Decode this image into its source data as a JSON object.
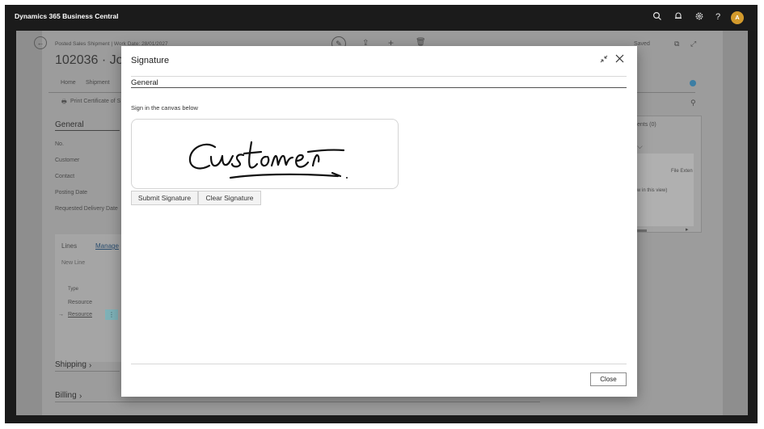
{
  "app": {
    "title": "Dynamics 365 Business Central",
    "user_initial": "A",
    "icons": [
      "search-icon",
      "bell-icon",
      "gear-icon",
      "help-icon"
    ]
  },
  "background_page": {
    "breadcrumb": "Posted Sales Shipment | Work Date: 28/01/2027",
    "title": "102036 · Joh",
    "saved_status": "Saved",
    "actions": [
      "Home",
      "Shipment"
    ],
    "print_action": "Print Certificate of S",
    "general_header": "General",
    "fields": [
      "No.",
      "Customer",
      "Contact",
      "Posting Date",
      "Requested Delivery Date"
    ],
    "lines_tab": "Lines",
    "manage_tab": "Manage",
    "new_line": "New Line",
    "line_type_header": "Type",
    "line_rows": [
      "Resource",
      "Resource"
    ],
    "shipping_header": "Shipping",
    "billing_header": "Billing",
    "factbox_attachments": "ents (0)",
    "factbox_file": "File Exten",
    "factbox_note": "w in this view)"
  },
  "dialog": {
    "title": "Signature",
    "section": "General",
    "hint": "Sign in the canvas below",
    "signature_text": "Customer",
    "submit_label": "Submit Signature",
    "clear_label": "Clear Signature",
    "close_label": "Close"
  }
}
